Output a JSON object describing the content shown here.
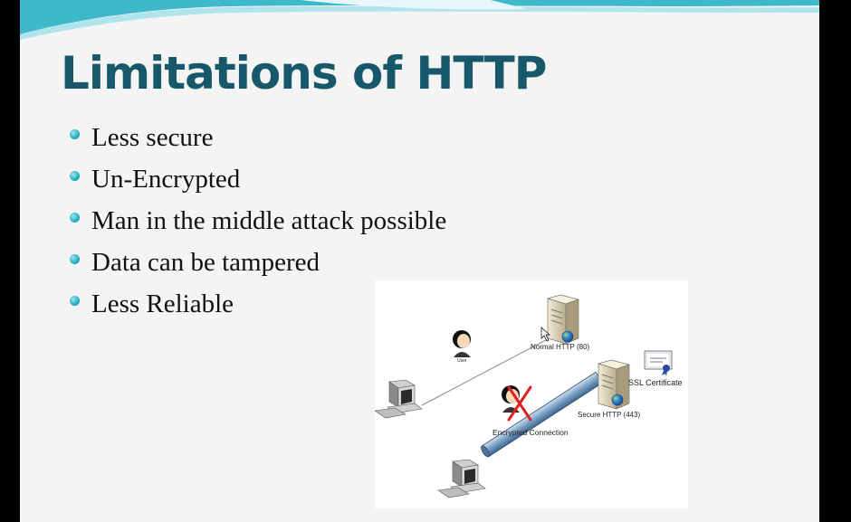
{
  "slide": {
    "title": "Limitations of HTTP",
    "accent_color": "#17596b",
    "bullet_color": "#2ab3c6",
    "bullets": [
      "Less secure",
      "Un-Encrypted",
      "Man in the middle attack possible",
      "Data can be tampered",
      "Less Reliable"
    ]
  },
  "diagram": {
    "normal_server_label": "Normal HTTP (80)",
    "secure_server_label": "Secure HTTP (443)",
    "ssl_label": "SSL Certificate",
    "tunnel_label": "Encrypted Connection",
    "user_label": "User",
    "icons": [
      "server-icon",
      "computer-icon",
      "user-icon",
      "ssl-certificate-icon",
      "cross-icon"
    ]
  }
}
